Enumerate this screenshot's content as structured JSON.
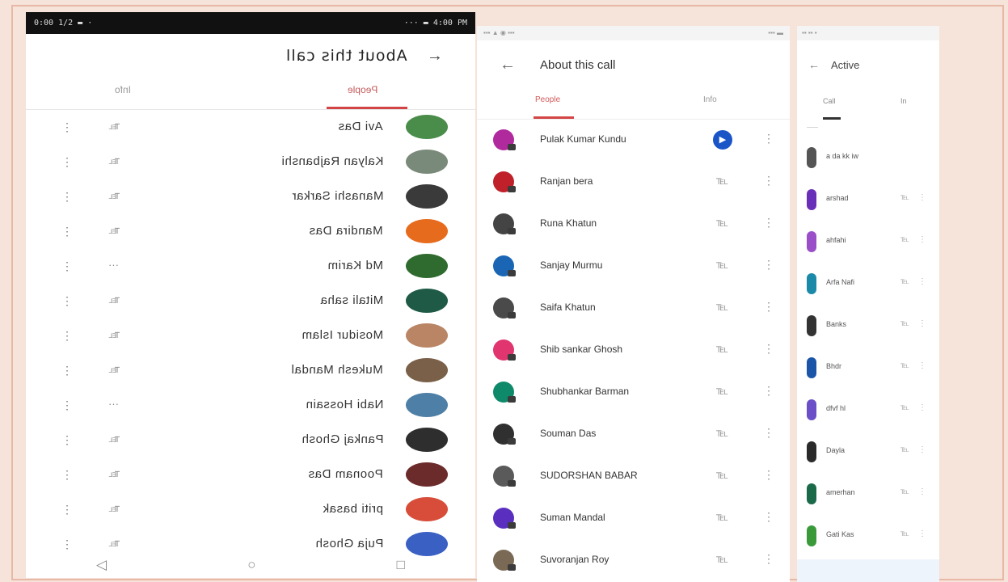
{
  "panel1": {
    "status_left": "0:00 1/2 ▬ ·",
    "status_right": "··· ▬ 4:00 PM",
    "title": "About this call",
    "back_icon": "arrow-back-icon",
    "tabs": [
      {
        "label": "People",
        "active": true
      },
      {
        "label": "Info",
        "active": false
      }
    ],
    "rows": [
      {
        "name": "Avi Das",
        "call": "℡",
        "color": "#4a8c4a"
      },
      {
        "name": "Kalyan Rajbanshi",
        "call": "℡",
        "color": "#7a8a7a"
      },
      {
        "name": "Manashi Sarkar",
        "call": "℡",
        "color": "#3a3a3a"
      },
      {
        "name": "Mandira Das",
        "call": "℡",
        "color": "#e66b1d"
      },
      {
        "name": "Md Karim",
        "call": "···",
        "color": "#2f6b2f"
      },
      {
        "name": "Mitali saha",
        "call": "℡",
        "color": "#1e5a45"
      },
      {
        "name": "Mosidur Islam",
        "call": "℡",
        "color": "#b98565"
      },
      {
        "name": "Mukesh Mandal",
        "call": "℡",
        "color": "#7a6048"
      },
      {
        "name": "Nabi Hossain",
        "call": "···",
        "color": "#4e7fa6"
      },
      {
        "name": "Pankaj Ghosh",
        "call": "℡",
        "color": "#2e2e2e"
      },
      {
        "name": "Poonam Das",
        "call": "℡",
        "color": "#6b2b2b"
      },
      {
        "name": "priti basak",
        "call": "℡",
        "color": "#d84d3a"
      },
      {
        "name": "Puja Ghosh",
        "call": "℡",
        "color": "#3a60c4"
      }
    ],
    "nav": [
      "◁",
      "○",
      "□"
    ]
  },
  "panel2": {
    "status_left": "▪▪▪ ▲ ◉ ▪▪▪",
    "status_right": "▪▪▪ ▬",
    "title": "About this call",
    "tabs": {
      "active": "People",
      "other": "Info"
    },
    "rows": [
      {
        "name": "Pulak Kumar Kundu",
        "color": "#b02a9e",
        "call": "▶",
        "video": true
      },
      {
        "name": "Ranjan bera",
        "color": "#c0202a",
        "call": "℡",
        "video": false
      },
      {
        "name": "Runa Khatun",
        "color": "#444444",
        "call": "℡",
        "video": false
      },
      {
        "name": "Sanjay Murmu",
        "color": "#1a66b5",
        "call": "℡",
        "video": false
      },
      {
        "name": "Saifa Khatun",
        "color": "#4a4a4a",
        "call": "℡",
        "video": false
      },
      {
        "name": "Shib sankar Ghosh",
        "color": "#e0356e",
        "call": "℡",
        "video": false
      },
      {
        "name": "Shubhankar Barman",
        "color": "#0e8a6a",
        "call": "℡",
        "video": false
      },
      {
        "name": "Souman Das",
        "color": "#303030",
        "call": "℡",
        "video": false
      },
      {
        "name": "SUDORSHAN BABAR",
        "color": "#5a5a5a",
        "call": "℡",
        "video": false
      },
      {
        "name": "Suman Mandal",
        "color": "#5a2fc0",
        "call": "℡",
        "video": false
      },
      {
        "name": "Suvoranjan Roy",
        "color": "#7a6a55",
        "call": "℡",
        "video": false
      }
    ]
  },
  "panel3": {
    "status": "▪▪ ▪▪ ▪",
    "title": "Active",
    "tabs": [
      "Call",
      "In"
    ],
    "sub": "——",
    "rows": [
      {
        "name": "a da kk iw",
        "color": "#555555",
        "icons": false
      },
      {
        "name": "arshad",
        "color": "#6a2fb8",
        "icons": true
      },
      {
        "name": "ahfahi",
        "color": "#9a4fc8",
        "icons": true
      },
      {
        "name": "Arfa Nafi",
        "color": "#1a8aa8",
        "icons": true
      },
      {
        "name": "Banks",
        "color": "#333333",
        "icons": true
      },
      {
        "name": "Bhdr",
        "color": "#1a55a8",
        "icons": true
      },
      {
        "name": "dfvf hl",
        "color": "#6a4fc8",
        "icons": true
      },
      {
        "name": "Dayla",
        "color": "#2a2a2a",
        "icons": true
      },
      {
        "name": "amerhan",
        "color": "#1a6a4a",
        "icons": true
      },
      {
        "name": "Gati Kas",
        "color": "#3a9a3a",
        "icons": true
      }
    ]
  }
}
